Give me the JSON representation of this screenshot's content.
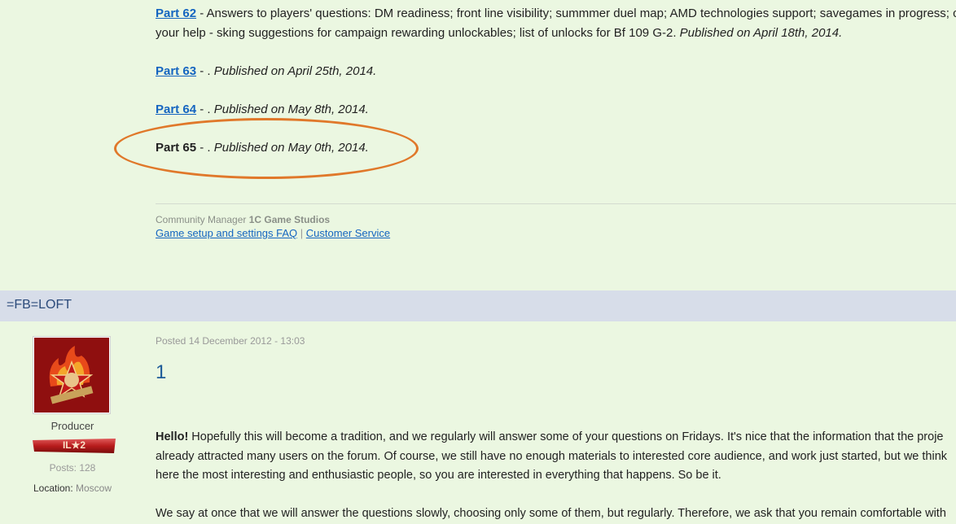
{
  "parts": [
    {
      "label": "Part 62",
      "linked": true,
      "desc_line1": " - Answers to players' questions: DM readiness; front line visibility; summmer duel map; AMD technologies support; savegames in progress; cha",
      "desc_line2": "your help - sking suggestions for campaign rewarding unlockables; list of unlocks for Bf 109 G-2. ",
      "published": "Published on April 18th, 2014."
    },
    {
      "label": "Part 63",
      "linked": true,
      "desc": " - . ",
      "published": "Published on April 25th, 2014."
    },
    {
      "label": "Part 64",
      "linked": true,
      "desc": " - . ",
      "published": "Published on May 8th, 2014."
    },
    {
      "label": "Part 65",
      "linked": false,
      "desc": " - . ",
      "published": "Published on May 0th, 2014."
    }
  ],
  "signature": {
    "role_prefix": "Community Manager ",
    "company": "1C Game Studios",
    "link1": "Game setup and settings FAQ",
    "separator": "|",
    "link2": "Customer Service"
  },
  "post": {
    "username": "=FB=LOFT",
    "user_role": "Producer",
    "rank_label": "IL★2",
    "posts_label": "Posts: 128",
    "location_label": "Location:",
    "location_value": "Moscow",
    "posted_label": "Posted",
    "posted_date": "14 December 2012 - 13:03",
    "post_number": "1",
    "hello": "Hello!",
    "body_line1": " Hopefully this will become a tradition, and we regularly will answer some of your questions on Fridays. It's nice that the information that the proje",
    "body_line2": "already attracted many users on the forum. Of course, we still have no enough materials to interested core audience, and work just started, but we think",
    "body_line3": "here the most interesting and enthusiastic people, so you are interested in everything that happens. So be it.",
    "body_line4": "We say at once that we will answer the questions slowly, choosing only some of them, but regularly. Therefore, we ask that you remain comfortable with"
  },
  "colors": {
    "background": "#ebf7e1",
    "link": "#1565c0",
    "highlight_oval": "#e0782a",
    "userbar": "#d7dde9"
  }
}
